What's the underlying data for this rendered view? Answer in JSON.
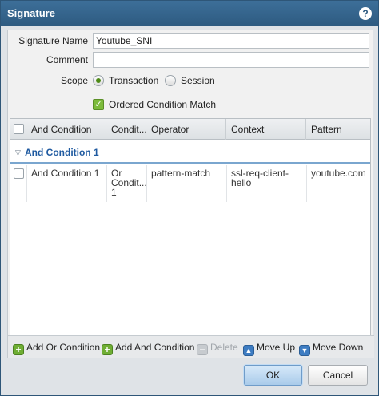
{
  "dialog": {
    "title": "Signature",
    "help_icon": "help-icon",
    "help_glyph": "?"
  },
  "form": {
    "signature_name_label": "Signature Name",
    "signature_name_value": "Youtube_SNI",
    "comment_label": "Comment",
    "comment_value": "",
    "scope_label": "Scope",
    "scope_options": [
      "Transaction",
      "Session"
    ],
    "scope_selected": "Transaction",
    "ordered_condition_match_label": "Ordered Condition Match",
    "ordered_condition_match_checked": true,
    "check_glyph": "✓"
  },
  "grid": {
    "columns": [
      "And Condition",
      "Condit...",
      "Operator",
      "Context",
      "Pattern"
    ],
    "group": {
      "label": "And Condition 1",
      "tri_glyph": "▽"
    },
    "rows": [
      {
        "and_condition": "And Condition 1",
        "or_condition": [
          "Or",
          "Condit...",
          "1"
        ],
        "operator": "pattern-match",
        "context": "ssl-req-client-hello",
        "pattern": "youtube.com"
      }
    ]
  },
  "toolbar": {
    "add_or": "Add Or Condition",
    "add_and": "Add And Condition",
    "delete": "Delete",
    "move_up": "Move Up",
    "move_down": "Move Down",
    "plus_glyph": "+",
    "minus_glyph": "−",
    "up_glyph": "▲",
    "down_glyph": "▼"
  },
  "footer": {
    "ok": "OK",
    "cancel": "Cancel"
  }
}
